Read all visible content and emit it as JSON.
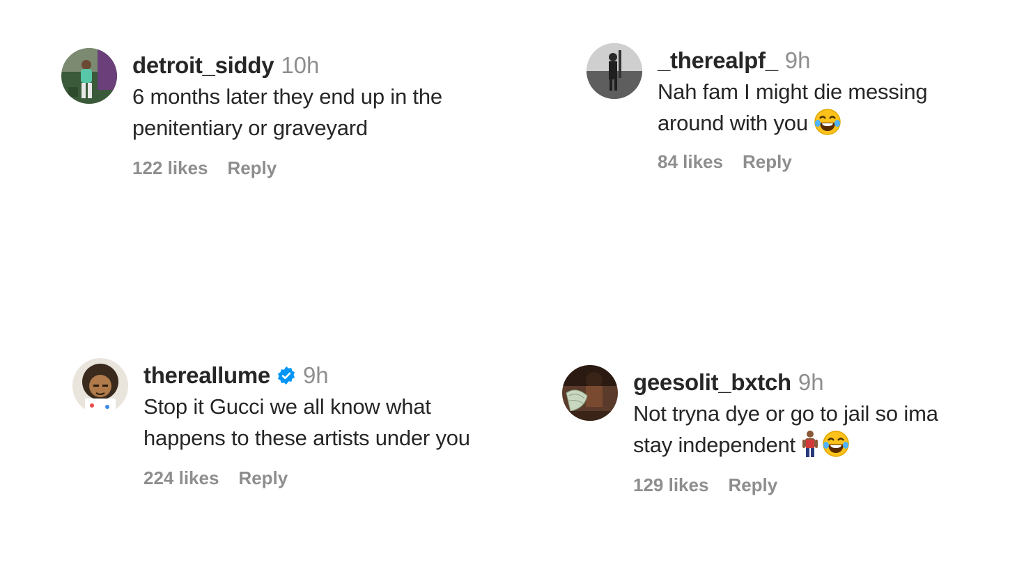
{
  "comments": [
    {
      "username": "detroit_siddy",
      "time": "10h",
      "text_lines": [
        "6 months later they end up in the",
        "penitentiary or graveyard"
      ],
      "likes": "122 likes",
      "reply": "Reply",
      "verified": false
    },
    {
      "username": "_therealpf_",
      "time": "9h",
      "text_lines": [
        "Nah fam I might die messing",
        "around with you"
      ],
      "trailing_emoji": [
        "face-with-tears-of-joy-icon"
      ],
      "likes": "84 likes",
      "reply": "Reply",
      "verified": false
    },
    {
      "username": "thereallume",
      "time": "9h",
      "text_lines": [
        "Stop it Gucci we all know what",
        "happens to these artists under you"
      ],
      "likes": "224 likes",
      "reply": "Reply",
      "verified": true
    },
    {
      "username": "geesolit_bxtch",
      "time": "9h",
      "text_lines": [
        "Not tryna dye or go to jail so ima",
        "stay independent"
      ],
      "trailing_emoji": [
        "person-standing-icon",
        "face-with-tears-of-joy-icon"
      ],
      "likes": "129 likes",
      "reply": "Reply",
      "verified": false
    }
  ],
  "colors": {
    "text": "#262626",
    "muted": "#8e8e8e",
    "verified": "#0095f6",
    "emoji": "#fcc21b"
  }
}
